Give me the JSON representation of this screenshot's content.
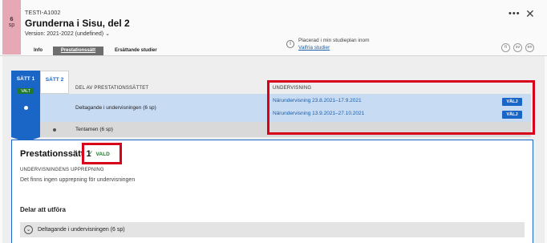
{
  "course": {
    "credits_value": "6",
    "credits_unit": "sp",
    "code": "TESTI-A1002",
    "title": "Grunderna i Sisu, del 2",
    "version": "Version: 2021-2022 (undefined)"
  },
  "plan_info": {
    "line1": "Placerad i min studieplan inom",
    "line2": "Valfria studier"
  },
  "lang_buttons": [
    "fi",
    "sv",
    "en"
  ],
  "tabs": [
    {
      "label": "Info"
    },
    {
      "label": "Prestationssätt"
    },
    {
      "label": "Ersättande studier"
    }
  ],
  "study_methods": [
    {
      "label": "SÄTT 1",
      "badge": "VALT"
    },
    {
      "label": "SÄTT 2"
    }
  ],
  "columns": {
    "part": "DEL AV PRESTATIONSSÄTTET",
    "teaching": "UNDERVISNING"
  },
  "rows": [
    {
      "name": "Deltagande i undervisningen (6 sp)",
      "teaching": [
        {
          "label": "Närundervisning 23.8.2021–17.9.2021",
          "button": "VÄLJ"
        },
        {
          "label": "Närundervisning 13.9.2021–27.10.2021",
          "button": "VÄLJ"
        }
      ]
    },
    {
      "name": "Tentamen (6 sp)"
    }
  ],
  "panel": {
    "title": "Prestationssätt 1",
    "status": "VALD",
    "repeat_header": "UNDERVISNINGENS UPPREPNING",
    "repeat_text": "Det finns ingen upprepning för undervisningen",
    "parts_header": "Delar att utföra",
    "parts": [
      {
        "label": "Deltagande i undervisningen (6 sp)"
      }
    ]
  },
  "colors": {
    "accent": "#1a66c7",
    "selected_row": "#c7dbf3",
    "success": "#1f7a2c",
    "highlight": "#d9001b",
    "credits_strip": "#e7a8b6"
  }
}
